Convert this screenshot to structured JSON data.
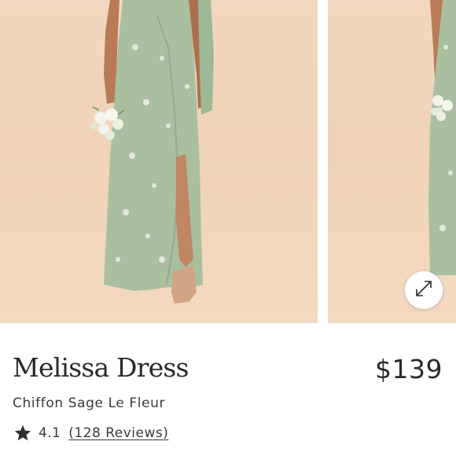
{
  "product": {
    "name": "Melissa Dress",
    "price": "$139",
    "variant": "Chiffon Sage Le Fleur",
    "rating": "4.1",
    "reviews_text": "(128 Reviews)"
  },
  "gallery": {
    "photos": [
      "product-photo-front",
      "product-photo-side"
    ],
    "expand_icon": "expand-icon"
  },
  "colors": {
    "background": "#f1d7bf",
    "dress": "#a9bfa0",
    "text": "#2a2a2a"
  }
}
